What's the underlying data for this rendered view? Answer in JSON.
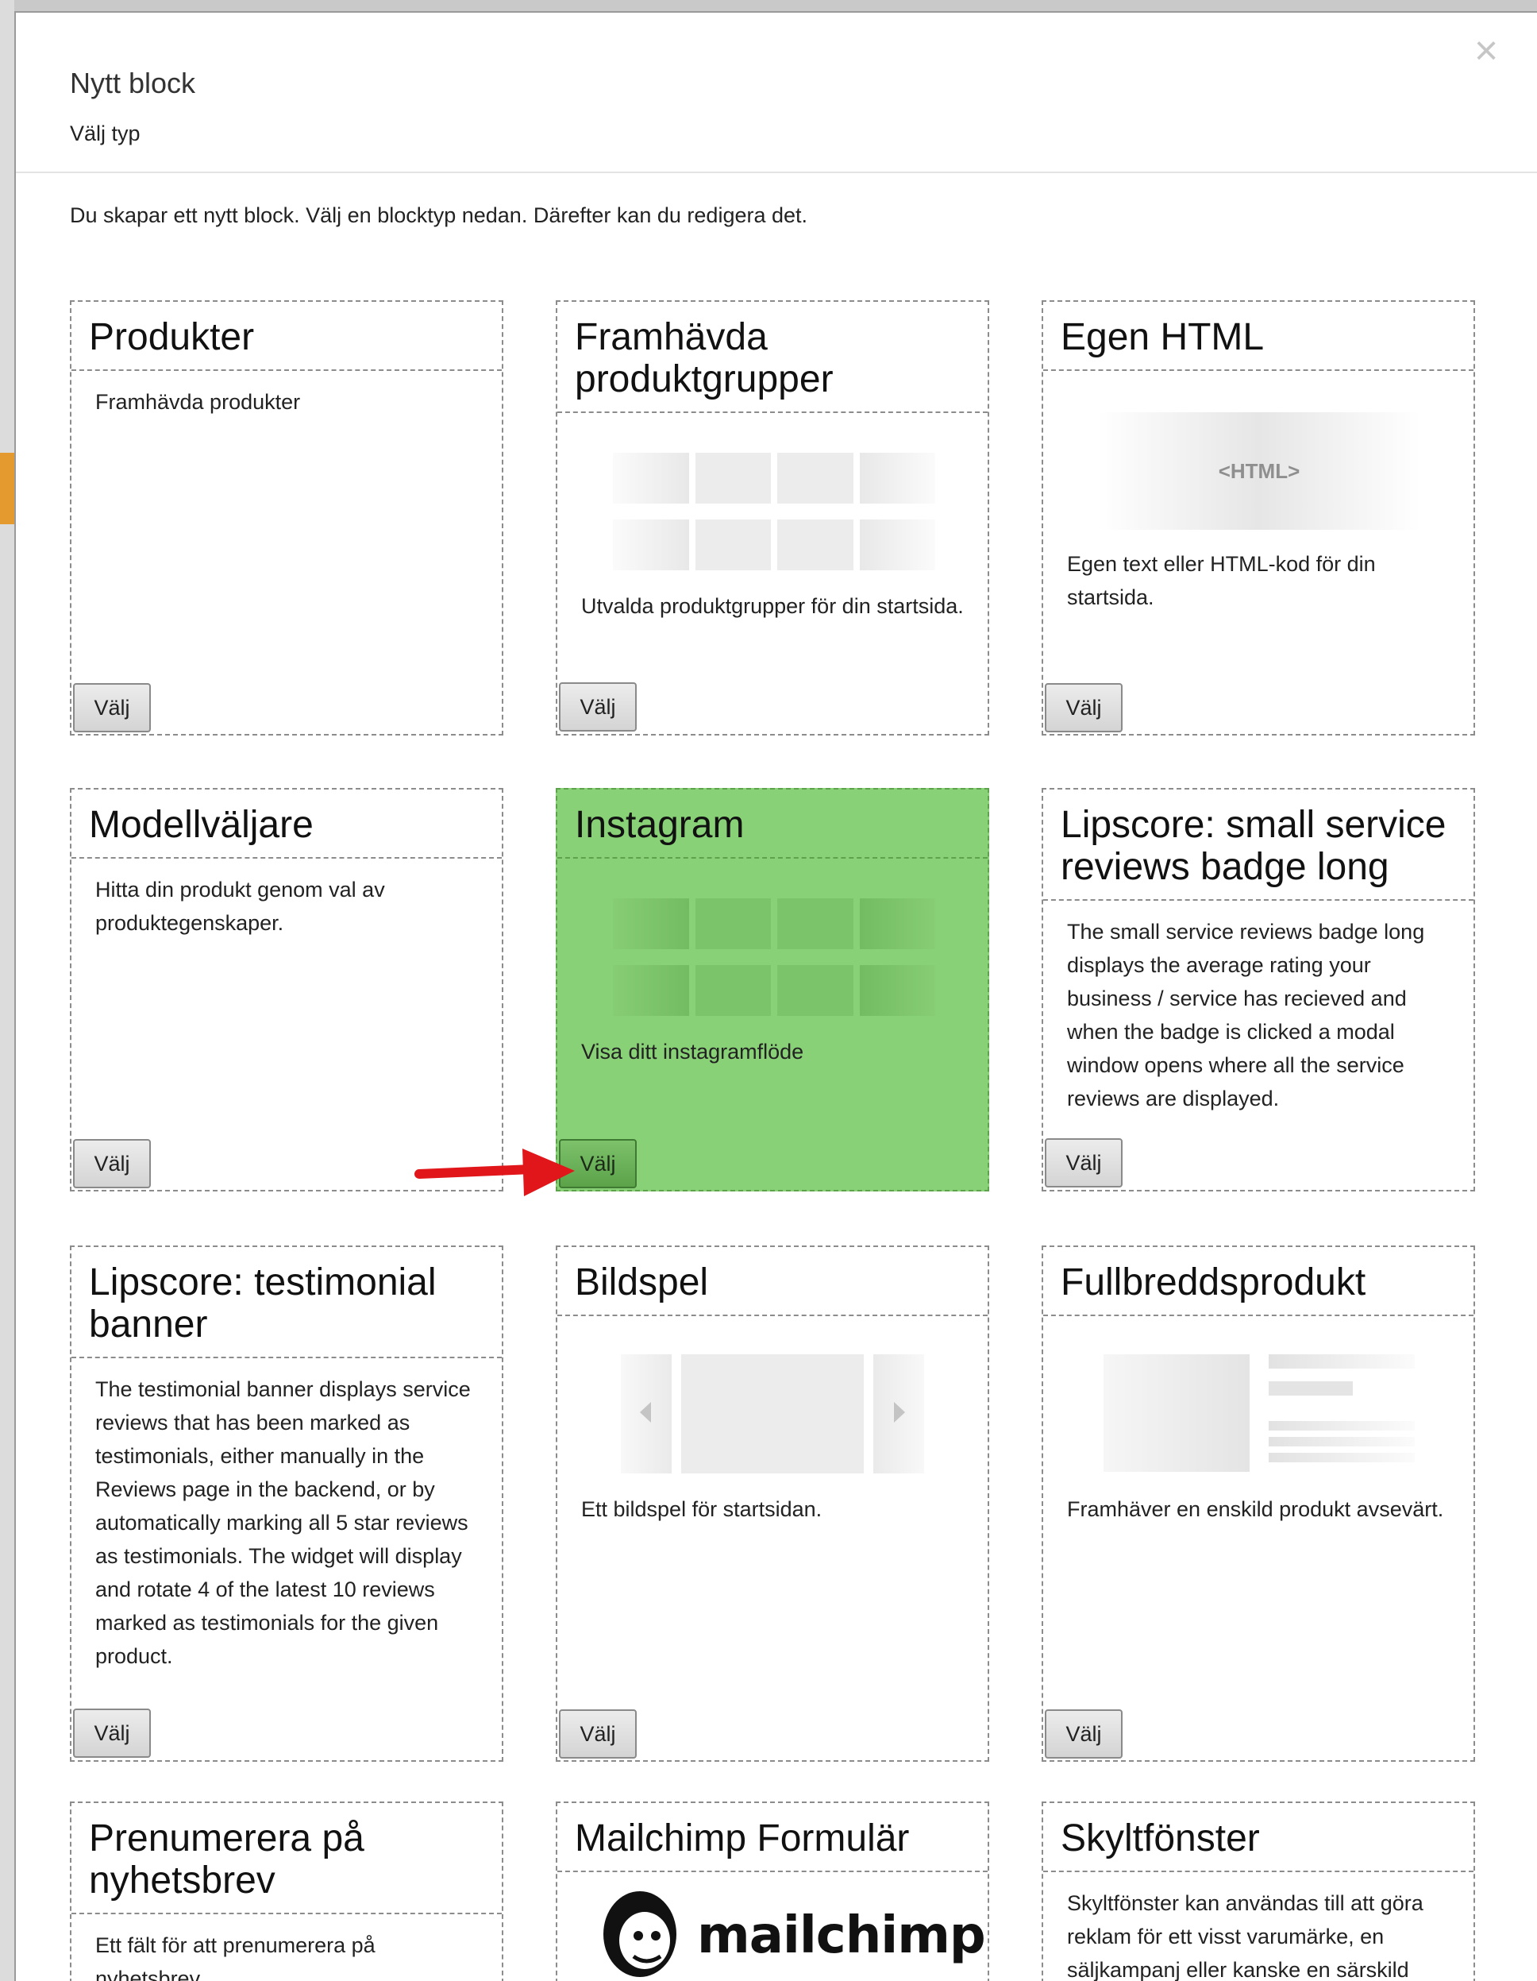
{
  "modal": {
    "title": "Nytt block",
    "subtitle": "Välj typ",
    "close": "×",
    "intro": "Du skapar ett nytt block. Välj en blocktyp nedan. Därefter kan du redigera det."
  },
  "select_label": "Välj",
  "mailchimp_logo_text": "mailchimp",
  "html_preview_text": "<HTML>",
  "cards": [
    {
      "title": "Produkter",
      "desc": "Framhävda produkter"
    },
    {
      "title": "Framhävda produktgrupper",
      "desc": "Utvalda produktgrupper för din startsida."
    },
    {
      "title": "Egen HTML",
      "desc": "Egen text eller HTML-kod för din startsida."
    },
    {
      "title": "Modellväljare",
      "desc": "Hitta din produkt genom val av produktegenskaper."
    },
    {
      "title": "Instagram",
      "desc": "Visa ditt instagramflöde",
      "selected": true
    },
    {
      "title": "Lipscore: small service reviews badge long",
      "desc": "The small service reviews badge long displays the average rating your business / service has recieved and when the badge is clicked a modal window opens where all the service reviews are displayed."
    },
    {
      "title": "Lipscore: testimonial banner",
      "desc": "The testimonial banner displays service reviews that has been marked as testimonials, either manually in the Reviews page in the backend, or by automatically marking all 5 star reviews as testimonials. The widget will display and rotate 4 of the latest 10 reviews marked as testimonials for the given product."
    },
    {
      "title": "Bildspel",
      "desc": "Ett bildspel för startsidan."
    },
    {
      "title": "Fullbreddsprodukt",
      "desc": "Framhäver en enskild produkt avsevärt."
    },
    {
      "title": "Prenumerera på nyhetsbrev",
      "desc": "Ett fält för att prenumerera på nyhetsbrev."
    },
    {
      "title": "Mailchimp Formulär",
      "desc": ""
    },
    {
      "title": "Skyltfönster",
      "desc": "Skyltfönster kan användas till att göra reklam för ett visst varumärke, en säljkampanj eller kanske en särskild"
    }
  ],
  "colors": {
    "selected_card": "#88d176",
    "annotation_arrow": "#e0161b"
  },
  "icons": [
    "close-icon",
    "arrow-left-icon",
    "arrow-right-icon",
    "mailchimp-logo-icon",
    "annotation-arrow-icon"
  ]
}
